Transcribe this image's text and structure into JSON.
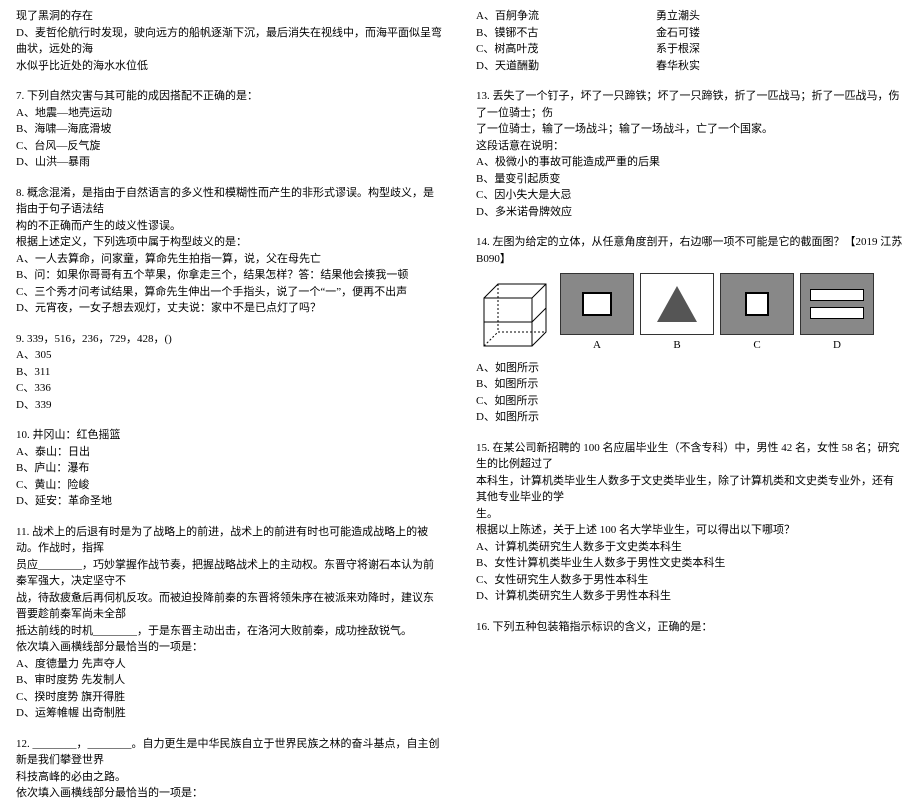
{
  "left": {
    "q6_tail": [
      "现了黑洞的存在",
      "D、麦哲伦航行时发现，驶向远方的船帆逐渐下沉，最后消失在视线中，而海平面似呈弯曲状，远处的海",
      "水似乎比近处的海水水位低"
    ],
    "q7": {
      "stem": "7. 下列自然灾害与其可能的成因搭配不正确的是：",
      "opts": [
        "A、地震—地壳运动",
        "B、海啸—海底滑坡",
        "C、台风—反气旋",
        "D、山洪—暴雨"
      ]
    },
    "q8": {
      "stem1": "8. 概念混淆，是指由于自然语言的多义性和模糊性而产生的非形式谬误。构型歧义，是指由于句子语法结",
      "stem2": "构的不正确而产生的歧义性谬误。",
      "stem3": "根据上述定义，下列选项中属于构型歧义的是：",
      "opts": [
        "A、一人去算命，问家童，算命先生拍指一算，说，父在母先亡",
        "B、问：如果你哥哥有五个苹果，你拿走三个，结果怎样？答：结果他会揍我一顿",
        "C、三个秀才问考试结果，算命先生伸出一个手指头，说了一个“一”，便再不出声",
        "D、元宵夜，一女子想去观灯，丈夫说：家中不是已点灯了吗？"
      ]
    },
    "q9": {
      "stem": "9. 339，516，236，729，428，()",
      "opts": [
        "A、305",
        "B、311",
        "C、336",
        "D、339"
      ]
    },
    "q10": {
      "stem": "10. 井冈山：红色摇篮",
      "opts": [
        "A、泰山：日出",
        "B、庐山：瀑布",
        "C、黄山：险峻",
        "D、延安：革命圣地"
      ]
    },
    "q11": {
      "stem": [
        "11. 战术上的后退有时是为了战略上的前进，战术上的前进有时也可能造成战略上的被动。作战时，指挥",
        "员应________，巧妙掌握作战节奏，把握战略战术上的主动权。东晋守将谢石本认为前秦军强大，决定坚守不",
        "战，待敌疲惫后再伺机反攻。而被迫投降前秦的东晋将领朱序在被派来劝降时，建议东晋要趁前秦军尚未全部",
        "抵达前线的时机________，于是东晋主动出击，在洛河大败前秦，成功挫敌锐气。",
        "依次填入画横线部分最恰当的一项是："
      ],
      "opts": [
        "A、度德量力  先声夺人",
        "B、审时度势  先发制人",
        "C、揆时度势  旗开得胜",
        "D、运筹帷幄  出奇制胜"
      ]
    },
    "q12": {
      "stem": [
        "12. ________，________。自力更生是中华民族自立于世界民族之林的奋斗基点，自主创新是我们攀登世界",
        "科技高峰的必由之路。",
        "依次填入画横线部分最恰当的一项是："
      ]
    }
  },
  "right": {
    "q12_opts": [
      {
        "a": "A、百舸争流",
        "b": "勇立潮头"
      },
      {
        "a": "B、镆铘不古",
        "b": "金石可镂"
      },
      {
        "a": "C、树高叶茂",
        "b": "系于根深"
      },
      {
        "a": "D、天道酬勤",
        "b": "春华秋实"
      }
    ],
    "q13": {
      "stem": [
        "13. 丢失了一个钉子，坏了一只蹄铁；坏了一只蹄铁，折了一匹战马；折了一匹战马，伤了一位骑士；伤",
        "了一位骑士，输了一场战斗；输了一场战斗，亡了一个国家。",
        "这段话意在说明："
      ],
      "opts": [
        "A、极微小的事故可能造成严重的后果",
        "B、量变引起质变",
        "C、因小失大是大忌",
        "D、多米诺骨牌效应"
      ]
    },
    "q14": {
      "stem": "14. 左图为给定的立体，从任意角度剖开，右边哪一项不可能是它的截面图？【2019 江苏 B090】",
      "labels": {
        "a": "A",
        "b": "B",
        "c": "C",
        "d": "D"
      },
      "opts": [
        "A、如图所示",
        "B、如图所示",
        "C、如图所示",
        "D、如图所示"
      ]
    },
    "q15": {
      "stem": [
        "15. 在某公司新招聘的 100 名应届毕业生（不含专科）中，男性 42 名，女性 58 名；研究生的比例超过了",
        "本科生，计算机类毕业生人数多于文史类毕业生，除了计算机类和文史类专业外，还有其他专业毕业的学",
        "生。",
        "根据以上陈述，关于上述 100 名大学毕业生，可以得出以下哪项？"
      ],
      "opts": [
        "A、计算机类研究生人数多于文史类本科生",
        "B、女性计算机类毕业生人数多于男性文史类本科生",
        "C、女性研究生人数多于男性本科生",
        "D、计算机类研究生人数多于男性本科生"
      ]
    },
    "q16": {
      "stem": "16. 下列五种包装箱指示标识的含义，正确的是："
    }
  }
}
